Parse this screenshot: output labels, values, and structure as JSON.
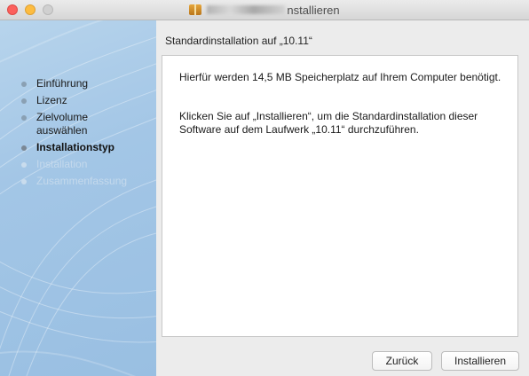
{
  "window": {
    "title_suffix": "nstallieren"
  },
  "heading": "Standardinstallation auf „10.11“",
  "sidebar": {
    "steps": [
      {
        "label": "Einführung",
        "state": "done"
      },
      {
        "label": "Lizenz",
        "state": "done"
      },
      {
        "label": "Zielvolume auswählen",
        "state": "done"
      },
      {
        "label": "Installationstyp",
        "state": "active"
      },
      {
        "label": "Installation",
        "state": "future"
      },
      {
        "label": "Zusammenfassung",
        "state": "future"
      }
    ]
  },
  "content": {
    "paragraph1": "Hierfür werden 14,5 MB Speicherplatz auf Ihrem Computer benötigt.",
    "paragraph2": "Klicken Sie auf „Installieren“, um die Standardinstallation dieser Software auf dem Laufwerk „10.11“ durchzuführen."
  },
  "buttons": {
    "back_label": "Zurück",
    "install_label": "Installieren"
  },
  "icons": {
    "window_icon": "package-icon"
  },
  "colors": {
    "close": "#fc605c",
    "minimize": "#fdbc40",
    "sidebar_bg": "#a3c6e6"
  }
}
